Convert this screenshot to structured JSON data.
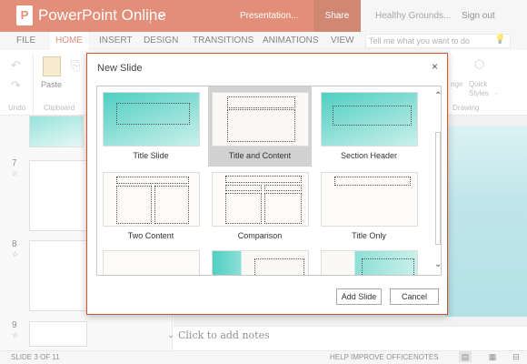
{
  "app": {
    "name": "PowerPoint Online",
    "document_title": "Presentation...",
    "share_label": "Share",
    "user_name": "Healthy Grounds...",
    "sign_out_label": "Sign out"
  },
  "tabs": [
    "FILE",
    "HOME",
    "INSERT",
    "DESIGN",
    "TRANSITIONS",
    "ANIMATIONS",
    "VIEW"
  ],
  "tell_me_placeholder": "Tell me what you want to do",
  "ribbon": {
    "paste_label": "Paste",
    "undo_label": "Undo",
    "clipboard_label": "Clipboard",
    "arrange_label": "nge",
    "quick_styles_label": "Quick Styles",
    "drawing_label": "Drawing",
    "slide_dash": "-"
  },
  "slide_pane": {
    "slide_numbers": [
      "7",
      "8",
      "9"
    ]
  },
  "notes_placeholder": "Click to add notes",
  "status": {
    "slide_info": "SLIDE 3 OF 11",
    "help_label": "HELP IMPROVE OFFICE",
    "notes_label": "NOTES"
  },
  "dialog": {
    "title": "New Slide",
    "close_glyph": "×",
    "layouts": [
      "Title Slide",
      "Title and Content",
      "Section Header",
      "Two Content",
      "Comparison",
      "Title Only"
    ],
    "selected_layout": "Title and Content",
    "add_label": "Add Slide",
    "cancel_label": "Cancel"
  },
  "colors": {
    "accent": "#d35230",
    "share_bg": "#b7472a",
    "teal": "#5fd3c8"
  }
}
